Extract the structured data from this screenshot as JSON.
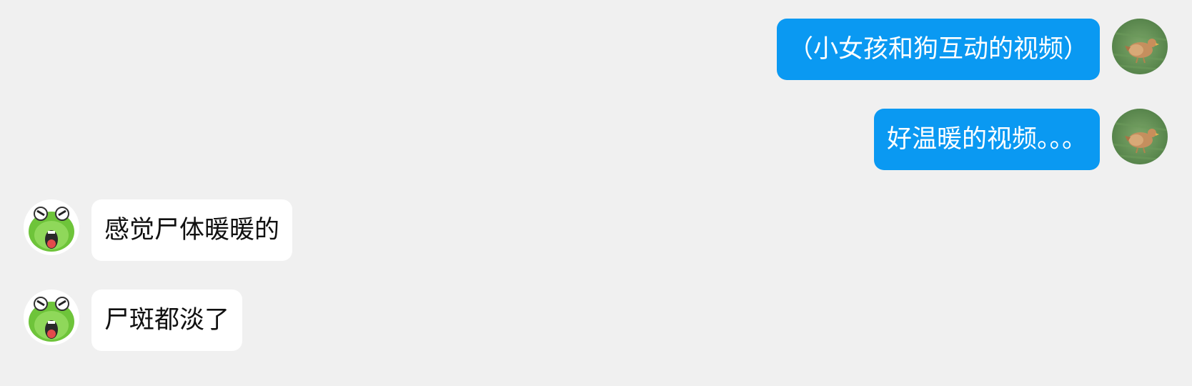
{
  "messages": [
    {
      "side": "outgoing",
      "text": "（小女孩和狗互动的视频）",
      "avatar": "chicken-in-grass-avatar"
    },
    {
      "side": "outgoing",
      "text": "好温暖的视频。。。",
      "avatar": "chicken-in-grass-avatar"
    },
    {
      "side": "incoming",
      "text": "感觉尸体暖暖的",
      "avatar": "green-frog-emoji-avatar"
    },
    {
      "side": "incoming",
      "text": "尸斑都淡了",
      "avatar": "green-frog-emoji-avatar"
    }
  ],
  "colors": {
    "background": "#f0f0f0",
    "outgoing_bubble": "#0a99f2",
    "incoming_bubble": "#ffffff"
  }
}
